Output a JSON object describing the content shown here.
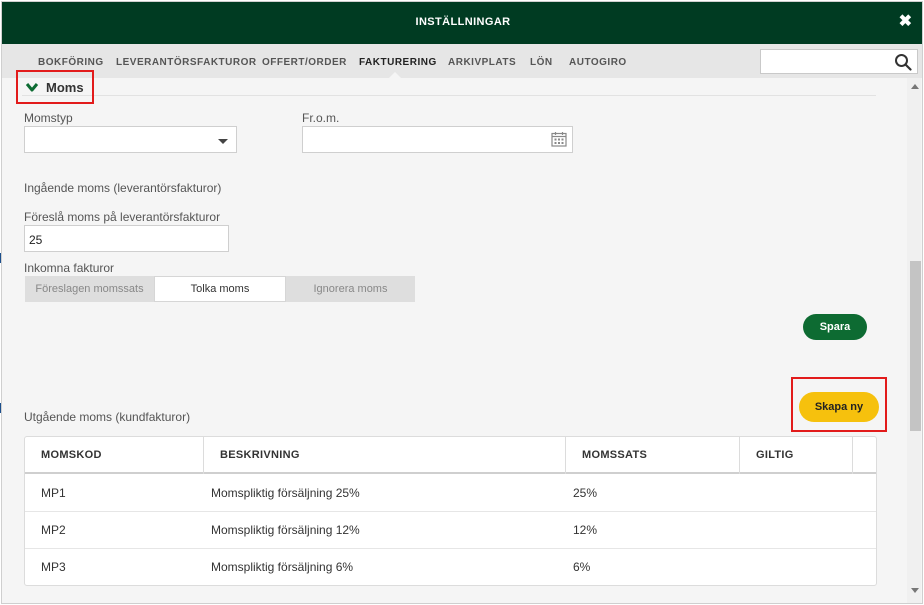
{
  "colors": {
    "header_bg": "#003b22",
    "save_button": "#0d6b32",
    "create_button": "#f6c10d",
    "highlight": "#e21b1b"
  },
  "dialog": {
    "title": "INSTÄLLNINGAR",
    "close_icon": "close-icon"
  },
  "tabs": [
    {
      "label": "BOKFÖRING"
    },
    {
      "label": "LEVERANTÖRSFAKTUROR"
    },
    {
      "label": "OFFERT/ORDER"
    },
    {
      "label": "FAKTURERING",
      "active": true
    },
    {
      "label": "ARKIVPLATS"
    },
    {
      "label": "LÖN"
    },
    {
      "label": "AUTOGIRO"
    }
  ],
  "search": {
    "value": "",
    "placeholder": "",
    "icon": "search-icon"
  },
  "section": {
    "title": "Moms",
    "icon": "chevron-down-icon"
  },
  "form": {
    "momstyp_label": "Momstyp",
    "momstyp_value": "",
    "from_label": "Fr.o.m.",
    "from_value": "",
    "calendar_icon": "calendar-icon",
    "incoming_heading": "Ingående moms (leverantörsfakturor)",
    "suggest_label": "Föreslå moms på leverantörsfakturor",
    "suggest_value": "25",
    "incoming_invoices_label": "Inkomna fakturor",
    "segment_options": [
      "Föreslagen momssats",
      "Tolka moms",
      "Ignorera moms"
    ],
    "segment_selected": "Tolka moms",
    "save_label": "Spara"
  },
  "outgoing": {
    "heading": "Utgående moms (kundfakturor)",
    "create_label": "Skapa ny",
    "columns": [
      "MOMSKOD",
      "BESKRIVNING",
      "MOMSSATS",
      "GILTIG"
    ],
    "rows": [
      [
        "MP1",
        "Momspliktig försäljning 25%",
        "25%",
        ""
      ],
      [
        "MP2",
        "Momspliktig försäljning 12%",
        "12%",
        ""
      ],
      [
        "MP3",
        "Momspliktig försäljning 6%",
        "6%",
        ""
      ]
    ]
  }
}
